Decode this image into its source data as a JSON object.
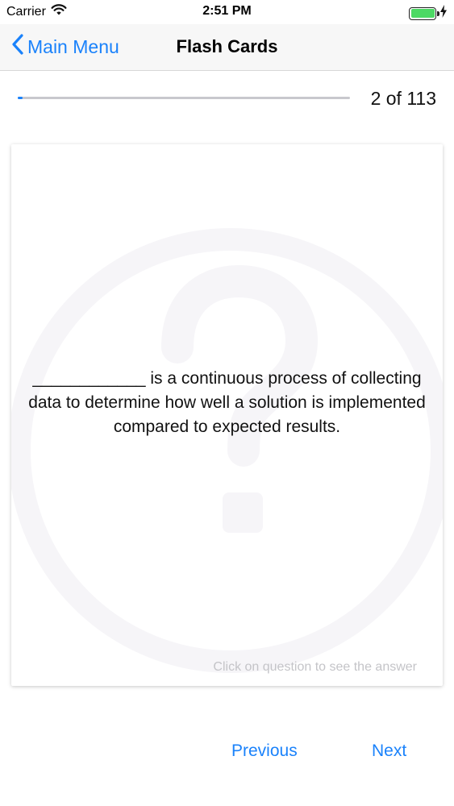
{
  "status_bar": {
    "carrier": "Carrier",
    "time": "2:51 PM",
    "icons": [
      "wifi-icon",
      "battery-icon",
      "charging-bolt-icon"
    ]
  },
  "nav": {
    "back_label": "Main Menu",
    "title": "Flash Cards"
  },
  "progress": {
    "counter": "2 of 113",
    "current": 2,
    "total": 113
  },
  "card": {
    "question": "____________ is a continuous process of collecting data to determine how well a solution is implemented compared to expected results.",
    "hint": "Click on question to see the answer",
    "watermark_icon": "question-mark-circle-icon"
  },
  "buttons": {
    "previous": "Previous",
    "next": "Next"
  },
  "colors": {
    "accent": "#1a82fb",
    "nav_background": "#f7f7f7",
    "battery": "#4cd964",
    "hint": "#c4c4c8"
  }
}
